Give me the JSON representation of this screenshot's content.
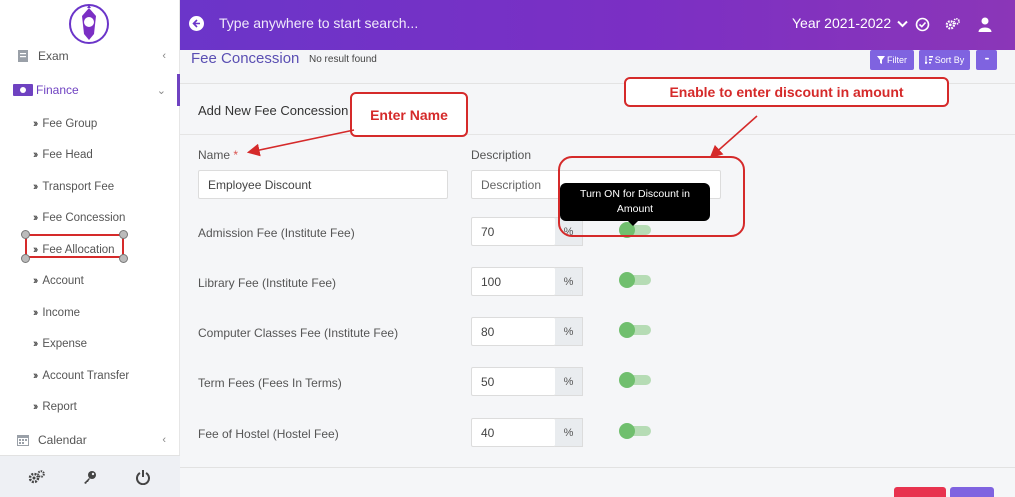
{
  "topbar": {
    "search_placeholder": "Type anywhere to start search...",
    "year_label": "Year 2021-2022"
  },
  "sidebar": {
    "exam": "Exam",
    "finance": "Finance",
    "sub_items": [
      "Fee Group",
      "Fee Head",
      "Transport Fee",
      "Fee Concession",
      "Fee Allocation",
      "Account",
      "Income",
      "Expense",
      "Account Transfer",
      "Report"
    ],
    "calendar": "Calendar"
  },
  "page": {
    "title": "Fee Concession",
    "subtitle": "No result found",
    "filter_label": "Filter",
    "sort_label": "Sort By",
    "more_label": "•••"
  },
  "form": {
    "card_title": "Add New Fee Concession",
    "name_label": "Name",
    "required_mark": "*",
    "name_value": "Employee Discount",
    "description_label": "Description",
    "description_placeholder": "Description",
    "fees": [
      {
        "label": "Admission Fee (Institute Fee)",
        "value": "70",
        "unit": "%"
      },
      {
        "label": "Library Fee (Institute Fee)",
        "value": "100",
        "unit": "%"
      },
      {
        "label": "Computer Classes Fee (Institute Fee)",
        "value": "80",
        "unit": "%"
      },
      {
        "label": "Term Fees (Fees In Terms)",
        "value": "50",
        "unit": "%"
      },
      {
        "label": "Fee of Hostel (Hostel Fee)",
        "value": "40",
        "unit": "%"
      }
    ]
  },
  "annotations": {
    "enter_name": "Enter Name",
    "enable_discount": "Enable to enter discount in amount",
    "tooltip": "Turn ON for Discount in Amount"
  },
  "colors": {
    "brand": "#6b35c9",
    "annotation": "#d52a2a",
    "toggle": "#70bf6e"
  }
}
